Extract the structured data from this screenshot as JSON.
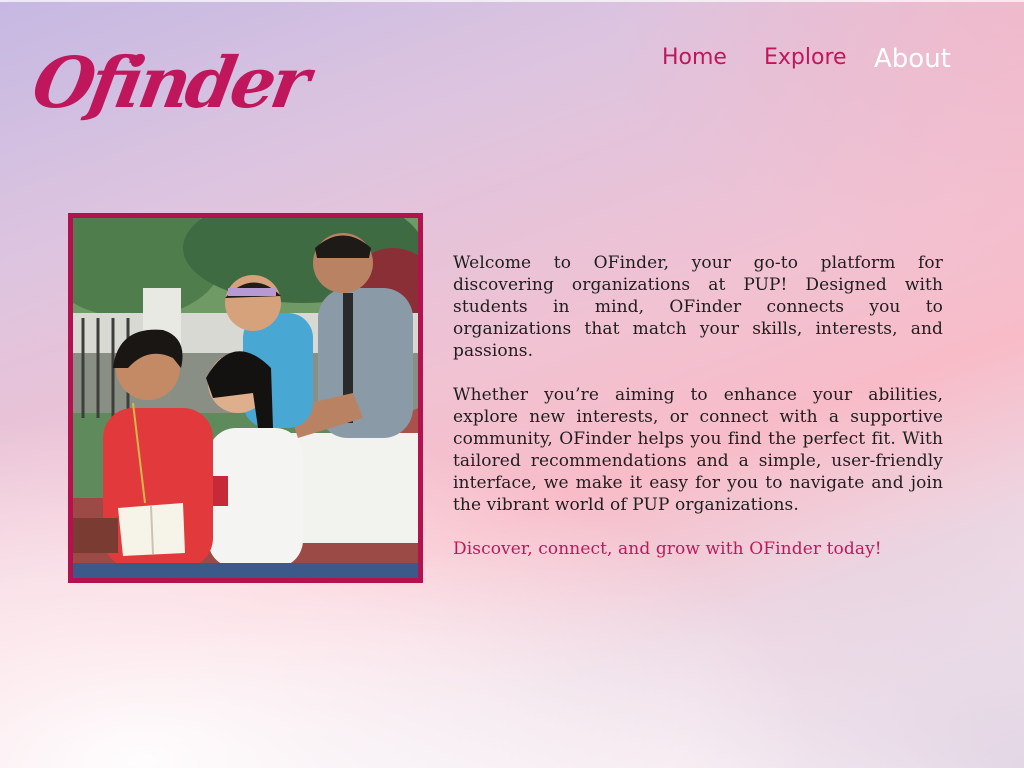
{
  "brand": {
    "logo_text": "Ofinder",
    "accent_color": "#c0175c",
    "frame_color": "#b3124f"
  },
  "nav": {
    "items": [
      {
        "label": "Home",
        "active": false
      },
      {
        "label": "Explore",
        "active": false
      },
      {
        "label": "About",
        "active": true
      }
    ]
  },
  "hero_image": {
    "subject": "students-sitting-on-bench-photo"
  },
  "about": {
    "paragraph_1": "Welcome to OFinder, your go-to platform for discovering organizations at PUP! Designed with students in mind, OFinder connects you to organizations that match your skills, interests, and passions.",
    "paragraph_2": "Whether you’re aiming to enhance your abilities, explore new interests, or connect with a supportive community, OFinder helps you find the perfect fit. With tailored recommendations and a simple, user-friendly interface, we make it easy for you to navigate and join the vibrant world of PUP organizations.",
    "tagline": "Discover, connect, and grow with OFinder today!"
  }
}
